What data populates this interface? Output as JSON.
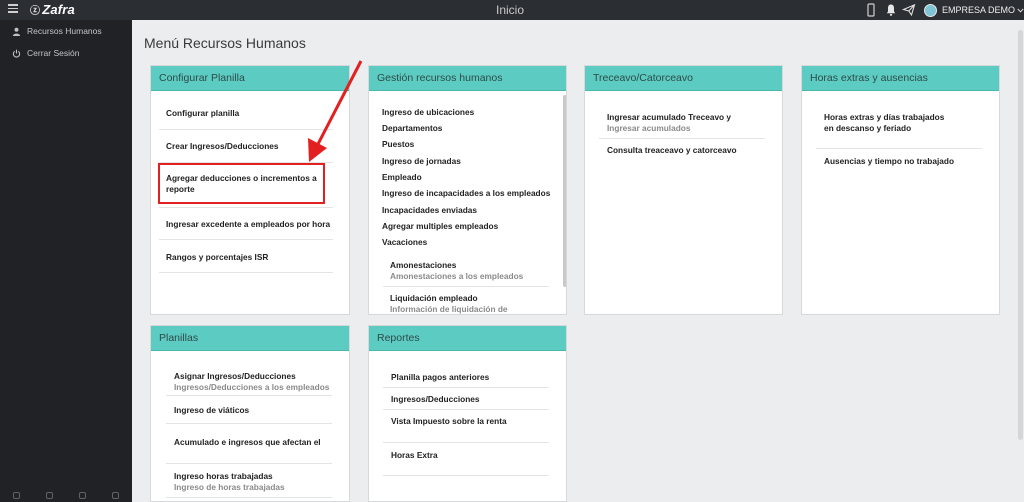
{
  "topbar": {
    "logo": "Zafra",
    "title": "Inicio",
    "user_name": "EMPRESA DEMO"
  },
  "sidebar": {
    "items": [
      {
        "label": "Recursos Humanos",
        "icon": "person-icon"
      },
      {
        "label": "Cerrar Sesión",
        "icon": "power-icon"
      }
    ]
  },
  "page": {
    "title": "Menú Recursos Humanos"
  },
  "cards": {
    "configurar": {
      "title": "Configurar Planilla",
      "items": [
        {
          "label": "Configurar planilla"
        },
        {
          "label": "Crear Ingresos/Deducciones"
        },
        {
          "label": "Agregar deducciones o incrementos a reporte"
        },
        {
          "label": "Ingresar excedente a empleados por hora"
        },
        {
          "label": "Rangos y porcentajes ISR"
        }
      ]
    },
    "gestion": {
      "title": "Gestión recursos humanos",
      "items": [
        {
          "label": "Ingreso de ubicaciones"
        },
        {
          "label": "Departamentos"
        },
        {
          "label": "Puestos"
        },
        {
          "label": "Ingreso de jornadas"
        },
        {
          "label": "Empleado"
        },
        {
          "label": "Ingreso de incapacidades a los empleados"
        },
        {
          "label": "Incapacidades enviadas"
        },
        {
          "label": "Agregar multiples empleados"
        },
        {
          "label": "Vacaciones"
        }
      ],
      "sub_items": [
        {
          "label": "Amonestaciones",
          "sub": "Amonestaciones a los empleados"
        },
        {
          "label": "Liquidación empleado",
          "sub": "Información de liquidación de"
        }
      ]
    },
    "treceavo": {
      "title": "Treceavo/Catorceavo",
      "items": [
        {
          "label": "Ingresar acumulado Treceavo y",
          "sub": "Ingresar acumulados"
        },
        {
          "label": "Consulta treaceavo y catorceavo"
        }
      ]
    },
    "horas": {
      "title": "Horas extras y ausencias",
      "items": [
        {
          "label": "Horas extras y días trabajados en descanso y feriado"
        },
        {
          "label": "Ausencias y tiempo no trabajado"
        }
      ]
    },
    "planillas": {
      "title": "Planillas",
      "items": [
        {
          "label": "Asignar Ingresos/Deducciones",
          "sub": "Ingresos/Deducciones a los empleados"
        },
        {
          "label": "Ingreso de viáticos"
        },
        {
          "label": "Acumulado e ingresos que afectan el"
        },
        {
          "label": "Ingreso horas trabajadas",
          "sub": "Ingreso de horas trabajadas"
        }
      ]
    },
    "reportes": {
      "title": "Reportes",
      "items": [
        {
          "label": "Planilla pagos anteriores"
        },
        {
          "label": "Ingresos/Deducciones"
        },
        {
          "label": "Vista Impuesto sobre la renta"
        },
        {
          "label": "Horas Extra"
        }
      ]
    }
  },
  "colors": {
    "header_teal": "#5ccbc2",
    "highlight_red": "#e32020",
    "sidebar_bg": "#202226",
    "topbar_bg": "#2b2e33"
  }
}
